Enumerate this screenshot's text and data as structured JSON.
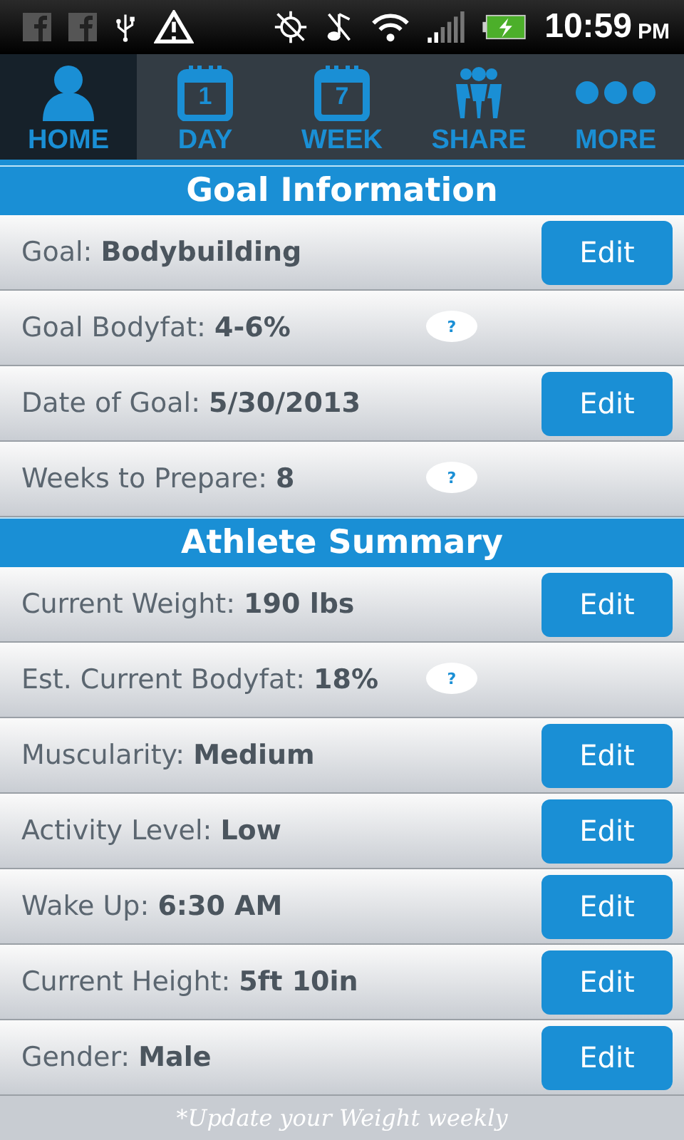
{
  "status_bar": {
    "time": "10:59",
    "ampm": "PM"
  },
  "tabs": [
    {
      "label": "HOME",
      "selected": true
    },
    {
      "label": "DAY",
      "badge": "1",
      "selected": false
    },
    {
      "label": "WEEK",
      "badge": "7",
      "selected": false
    },
    {
      "label": "SHARE",
      "selected": false
    },
    {
      "label": "MORE",
      "selected": false
    }
  ],
  "sections": [
    {
      "title": "Goal Information",
      "rows": [
        {
          "text": "Goal: **Bodybuilding**",
          "kind": "edit",
          "action": "Edit"
        },
        {
          "text": "Goal Bodyfat: **4-6%**",
          "kind": "help",
          "action": "?"
        },
        {
          "text": "Date of Goal: **5/30/2013**",
          "kind": "edit",
          "action": "Edit"
        },
        {
          "text": "Weeks to Prepare: **8**",
          "kind": "help",
          "action": "?"
        }
      ]
    },
    {
      "title": "Athlete Summary",
      "rows": [
        {
          "text": "Current Weight: **190 lbs**",
          "kind": "edit",
          "action": "Edit"
        },
        {
          "text": "Est. Current Bodyfat: **18%**",
          "kind": "help",
          "action": "?"
        },
        {
          "text": "Muscularity: **Medium**",
          "kind": "edit",
          "action": "Edit"
        },
        {
          "text": "Activity Level: **Low**",
          "kind": "edit",
          "action": "Edit"
        },
        {
          "text": "Wake Up: **6:30 AM**",
          "kind": "edit",
          "action": "Edit"
        },
        {
          "text": "Current Height: **5ft 10in**",
          "kind": "edit",
          "action": "Edit"
        },
        {
          "text": "Gender: **Male**",
          "kind": "edit",
          "action": "Edit"
        }
      ]
    }
  ],
  "footnote": "*Update your Weight weekly"
}
